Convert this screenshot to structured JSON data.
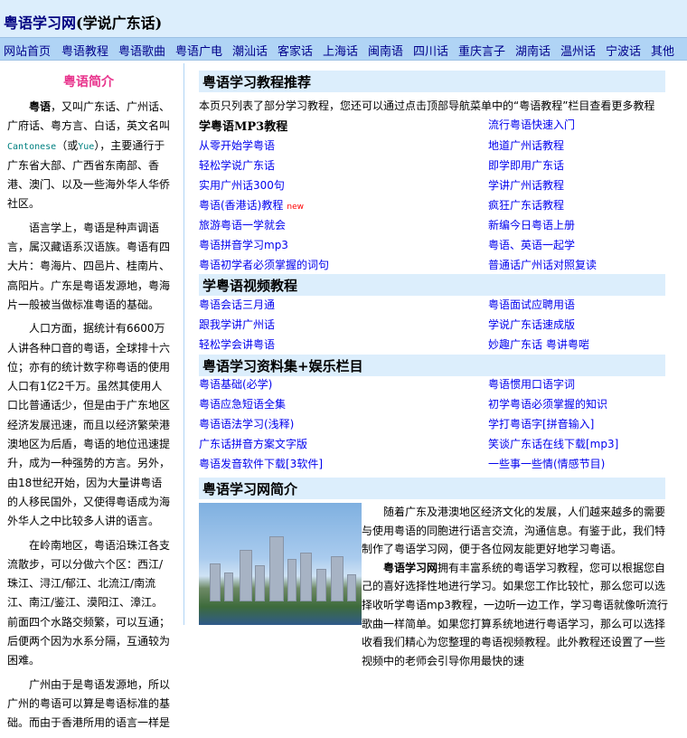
{
  "header": {
    "title": "粤语学习网",
    "subtitle": "(学说广东话)"
  },
  "nav": [
    "网站首页",
    "粤语教程",
    "粤语歌曲",
    "粤语广电",
    "潮汕话",
    "客家话",
    "上海话",
    "闽南语",
    "四川话",
    "重庆言子",
    "湖南话",
    "温州话",
    "宁波话",
    "其他"
  ],
  "sidebar": {
    "title": "粤语简介",
    "p1_bold": "粤语",
    "p1": "，又叫广东话、广州话、广府话、粤方言、白话，英文名叫",
    "p1_en": "Cantonese",
    "p1_mid": "（或",
    "p1_en2": "Yue",
    "p1_end": "），主要通行于广东省大部、广西省东南部、香港、澳门、以及一些海外华人华侨社区。",
    "p2": "语言学上，粤语是种声调语言，属汉藏语系汉语族。粤语有四大片：粤海片、四邑片、桂南片、高阳片。广东是粤语发源地，粤海片一般被当做标准粤语的基础。",
    "p3": "人口方面，据统计有6600万人讲各种口音的粤语，全球排十六位；亦有的统计数字称粤语的使用人口有1亿2千万。虽然其使用人口比普通话少，但是由于广东地区经济发展迅速，而且以经济繁荣港澳地区为后盾，粤语的地位迅速提升，成为一种强势的方言。另外，由18世纪开始，因为大量讲粤语的人移民国外，又使得粤语成为海外华人之中比较多人讲的语言。",
    "p4": "在岭南地区，粤语沿珠江各支流散步，可以分做六个区：西江/珠江、浔江/郁江、北流江/南流江、南江/鉴江、漠阳江、漳江。前面四个水路交频繁，可以互通；后便两个因为水系分隔，互通较为困难。",
    "p5": "广州由于是粤语发源地，所以广州的粤语可以算是粤语标准的基础。而由于香港所用的语言一样是"
  },
  "main": {
    "sec1": "粤语学习教程推荐",
    "intro": "本页只列表了部分学习教程，您还可以通过点击顶部导航菜单中的“粤语教程”栏目查看更多教程",
    "sub1": "学粤语MP3教程",
    "left1": [
      "从零开始学粤语",
      "轻松学说广东话",
      "实用广州话300句",
      "粤语(香港话)教程",
      "旅游粤语一学就会",
      "粤语拼音学习mp3",
      "粤语初学者必须掌握的词句"
    ],
    "new_tag": "new",
    "right1": [
      "流行粤语快速入门",
      "地道广州话教程",
      "即学即用广东话",
      "学讲广州话教程",
      "疯狂广东话教程",
      "新编今日粤语上册",
      "粤语、英语一起学",
      "普通话广州话对照复读"
    ],
    "sec2": "学粤语视频教程",
    "left2": [
      "粤语会话三月通",
      "跟我学讲广州话",
      "轻松学会讲粤语"
    ],
    "right2": [
      "粤语面试应聘用语",
      "学说广东话速成版",
      "妙趣广东话 粤讲粤啱"
    ],
    "sec3": "粤语学习资料集+娱乐栏目",
    "left3": [
      "粤语基础(必学)",
      "粤语应急短语全集",
      "粤语语法学习(浅释)",
      "广东话拼音方案文字版",
      "粤语发音软件下载[3软件]"
    ],
    "right3": [
      "粤语惯用口语字词",
      "初学粤语必须掌握的知识",
      "学打粤语字[拼音输入]",
      "笑谈广东话在线下载[mp3]",
      "一些事一些情(情感节目)"
    ],
    "sec4": "粤语学习网简介",
    "about_p1": "随着广东及港澳地区经济文化的发展，人们越来越多的需要与使用粤语的同胞进行语言交流，沟通信息。有鉴于此，我们特制作了粤语学习网，便于各位网友能更好地学习粤语。",
    "about_bold": "粤语学习网",
    "about_p2": "拥有丰富系统的粤语学习教程，您可以根据您自己的喜好选择性地进行学习。如果您工作比较忙，那么您可以选择收听学粤语mp3教程，一边听一边工作，学习粤语就像听流行歌曲一样简单。如果您打算系统地进行粤语学习，那么可以选择收看我们精心为您整理的粤语视频教程。此外教程还设置了一些视频中的老师会引导你用最快的速"
  },
  "colors": {
    "header_bg": "#dceefc",
    "nav_bg": "#b0d4f5",
    "link": "#0000ee",
    "side_title": "#e8338c"
  }
}
